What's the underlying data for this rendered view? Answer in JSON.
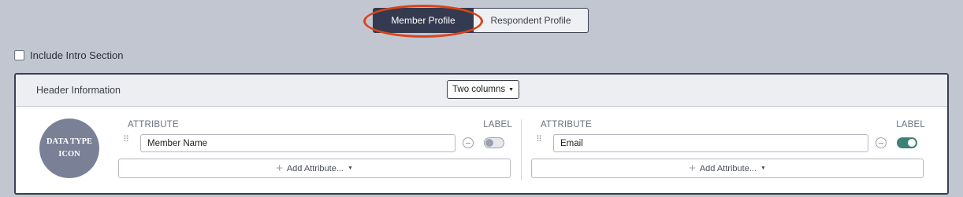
{
  "profile_tabs": {
    "active": "Member Profile",
    "inactive": "Respondent Profile"
  },
  "intro": {
    "label": "Include Intro Section",
    "checked": false
  },
  "header_panel": {
    "title": "Header Information",
    "layout_select": "Two columns",
    "data_type_icon": "DATA TYPE\nICON",
    "columns": [
      {
        "attribute_header": "ATTRIBUTE",
        "label_header": "LABEL",
        "attribute_value": "Member Name",
        "label_toggle_on": false,
        "add_attribute": "Add Attribute..."
      },
      {
        "attribute_header": "ATTRIBUTE",
        "label_header": "LABEL",
        "attribute_value": "Email",
        "label_toggle_on": true,
        "add_attribute": "Add Attribute..."
      }
    ]
  },
  "colors": {
    "active_tab": "#343a4f",
    "annotation": "#d9441c",
    "toggle_on": "#3f8074",
    "icon_circle": "#7a8197"
  }
}
